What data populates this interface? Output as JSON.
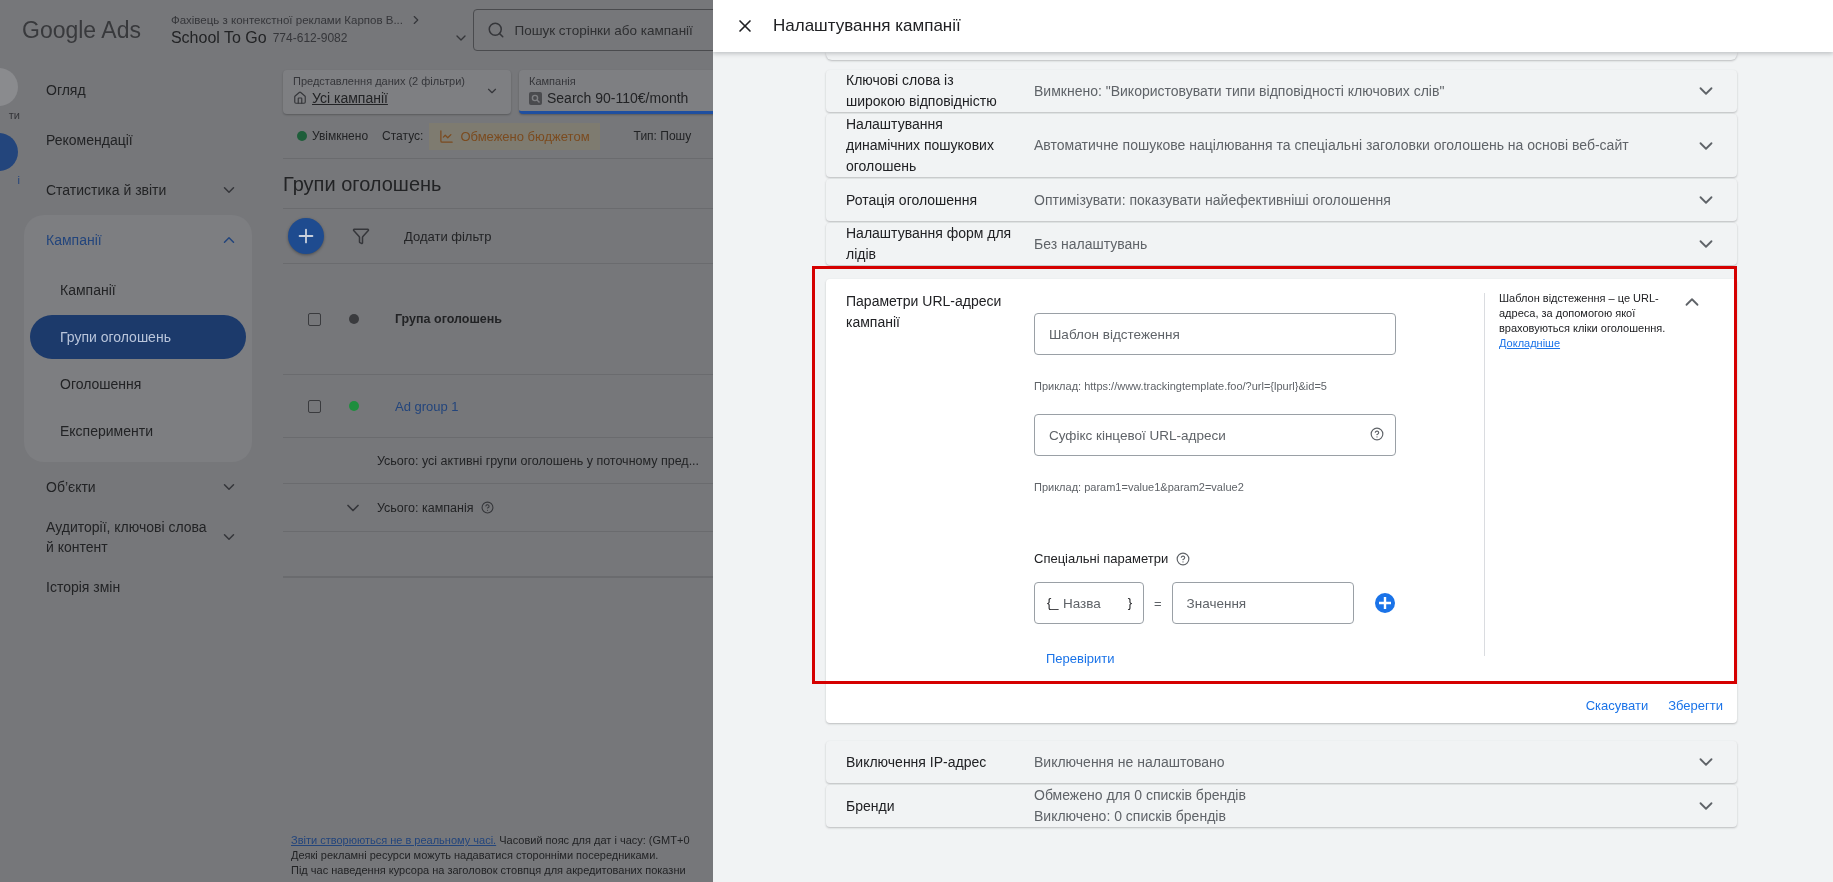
{
  "header": {
    "brand": "Google Ads",
    "account_path": "Фахівець з контекстної реклами Карпов В...",
    "account_name": "School To Go",
    "account_id": "774-612-9082",
    "search": {
      "placeholder": "Пошук сторінки або кампанії"
    }
  },
  "rail": [
    {
      "label": "ти",
      "selected": false
    },
    {
      "label": "і",
      "selected": true
    }
  ],
  "nav": [
    {
      "label": "Огляд",
      "kind": "link"
    },
    {
      "label": "Рекомендації",
      "kind": "link"
    },
    {
      "label": "Статистика й звіти",
      "kind": "menu",
      "expanded": false
    },
    {
      "label": "Кампанії",
      "kind": "menu",
      "expanded": true,
      "children": [
        {
          "label": "Кампанії",
          "selected": false
        },
        {
          "label": "Групи оголошень",
          "selected": true
        },
        {
          "label": "Оголошення",
          "selected": false
        },
        {
          "label": "Експерименти",
          "selected": false
        }
      ]
    },
    {
      "label": "Об’єкти",
      "kind": "menu",
      "expanded": false
    },
    {
      "label": "Аудиторії, ключові слова й контент",
      "kind": "menu",
      "expanded": false
    },
    {
      "label": "Історія змін",
      "kind": "link"
    }
  ],
  "filters": [
    {
      "kind": "view",
      "caption": "Представлення даних (2 фільтри)",
      "value": "Усі кампанії",
      "selected": false
    },
    {
      "kind": "campaign",
      "caption": "Кампанія",
      "value": "Search 90-110€/month",
      "selected": true
    }
  ],
  "status_bar": {
    "state": "Увімкнено",
    "status_label": "Статус:",
    "status_badge": "Обмежено бюджетом",
    "type_label": "Тип: Пошу"
  },
  "page_title": "Групи оголошень",
  "table": {
    "add_filter": "Додати фільтр",
    "header": {
      "label": "Група оголошень",
      "checked": false
    },
    "rows": [
      {
        "name": "Ad group 1",
        "checked": false,
        "color": "#1e8e3e"
      }
    ],
    "summary_rows": [
      {
        "kind": "plain",
        "text": "Усього: усі активні групи оголошень у поточному пред..."
      },
      {
        "kind": "expandable",
        "text": "Усього: кампанія"
      }
    ]
  },
  "footer": [
    {
      "link": "Звіти створюються не в реальному часі.",
      "text": "Часовий пояс для дат і часу: (GMT+0"
    },
    {
      "text": "Деякі рекламні ресурси можуть надаватися сторонніми посередниками."
    },
    {
      "text": "Під час наведення курсора на заголовок стовпця для акредитованих показни"
    }
  ],
  "panel": {
    "title": "Налаштування кампанії",
    "sections": [
      {
        "kind": "collapsed",
        "label": "Ключові слова із широкою відповідністю",
        "values": [
          "Вимкнено: \"Використовувати типи відповідності ключових слів\""
        ],
        "expanded": false
      },
      {
        "kind": "collapsed",
        "label": "Налаштування динамічних пошукових оголошень",
        "values": [
          "Автоматичне пошукове націлювання та спеціальні заголовки оголошень на основі веб-сайт"
        ],
        "expanded": false
      },
      {
        "kind": "collapsed",
        "label": "Ротація оголошення",
        "values": [
          "Оптимізувати: показувати найефективніші оголошення"
        ],
        "expanded": false
      },
      {
        "kind": "collapsed",
        "label": "Налаштування форм для лідів",
        "values": [
          "Без налаштувань"
        ],
        "expanded": false
      },
      {
        "kind": "url",
        "label": "Параметри URL-адреси кампанії",
        "expanded": true,
        "highlighted": true,
        "fields": [
          {
            "placeholder": "Шаблон відстеження",
            "help": false,
            "example": "Приклад: https://www.trackingtemplate.foo/?url={lpurl}&id=5"
          },
          {
            "placeholder": "Суфікс кінцевої URL-адреси",
            "help": true,
            "example": "Приклад: param1=value1&param2=value2"
          }
        ],
        "custom_params": {
          "label": "Спеціальні параметри",
          "name_open": "{_",
          "name_placeholder": "Назва",
          "name_close": "}",
          "equals": "=",
          "value_placeholder": "Значення"
        },
        "check_link": "Перевірити",
        "help_text": "Шаблон відстеження – це URL-адреса, за допомогою якої враховуються кліки оголошення.",
        "help_link": "Докладніше",
        "actions": [
          "Скасувати",
          "Зберегти"
        ]
      },
      {
        "kind": "collapsed",
        "label": "Виключення IP-адрес",
        "values": [
          "Виключення не налаштовано"
        ],
        "expanded": false
      },
      {
        "kind": "collapsed",
        "label": "Бренди",
        "values": [
          "Обмежено для 0 списків брендів",
          "Виключено: 0 списків брендів"
        ],
        "expanded": false
      }
    ]
  }
}
